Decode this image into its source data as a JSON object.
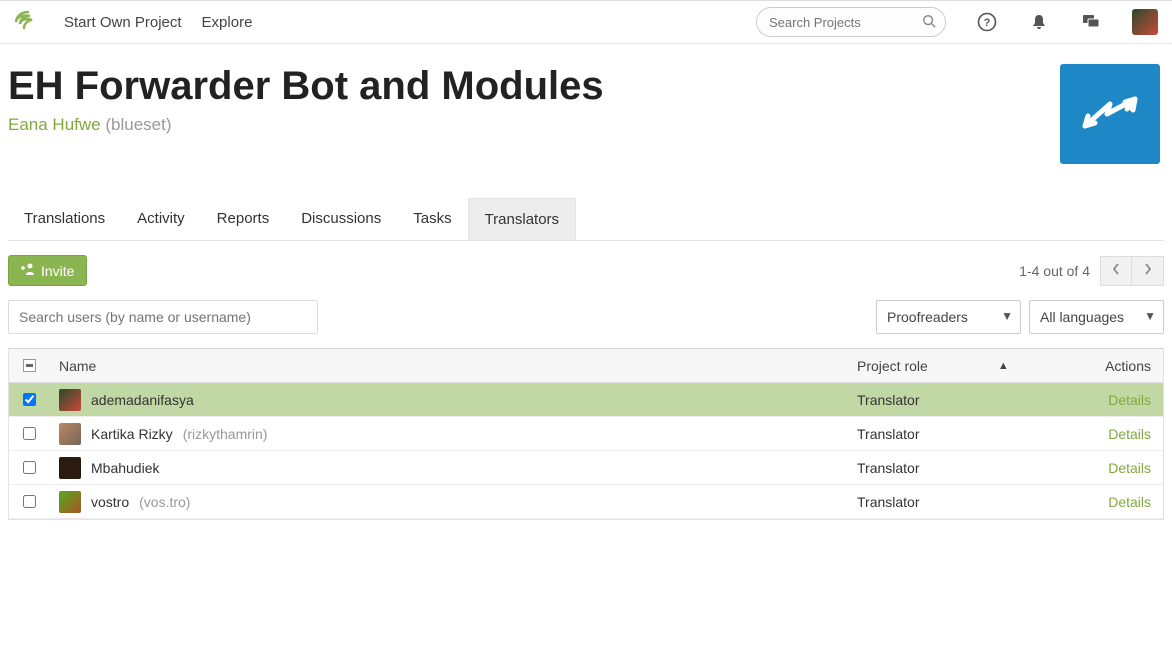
{
  "nav": {
    "start": "Start Own Project",
    "explore": "Explore"
  },
  "search": {
    "placeholder": "Search Projects"
  },
  "header": {
    "title": "EH Forwarder Bot and Modules",
    "owner_name": "Eana Hufwe",
    "owner_username": "(blueset)"
  },
  "tabs": {
    "translations": "Translations",
    "activity": "Activity",
    "reports": "Reports",
    "discussions": "Discussions",
    "tasks": "Tasks",
    "translators": "Translators"
  },
  "toolbar": {
    "invite": "Invite",
    "pager": "1-4 out of 4"
  },
  "filters": {
    "search_placeholder": "Search users (by name or username)",
    "role": "Proofreaders",
    "lang": "All languages"
  },
  "table": {
    "head": {
      "name": "Name",
      "role": "Project role",
      "actions": "Actions"
    },
    "rows": [
      {
        "selected": true,
        "name": "ademadanifasya",
        "sub": "",
        "role": "Translator",
        "action": "Details",
        "avatar_bg": "linear-gradient(135deg,#2a4a2a,#c94a3a)"
      },
      {
        "selected": false,
        "name": "Kartika Rizky ",
        "sub": "(rizkythamrin)",
        "role": "Translator",
        "action": "Details",
        "avatar_bg": "linear-gradient(135deg,#b86,#765)"
      },
      {
        "selected": false,
        "name": "Mbahudiek",
        "sub": "",
        "role": "Translator",
        "action": "Details",
        "avatar_bg": "#2b1a10"
      },
      {
        "selected": false,
        "name": "vostro ",
        "sub": "(vos.tro)",
        "role": "Translator",
        "action": "Details",
        "avatar_bg": "linear-gradient(135deg,#5a2,#a52)"
      }
    ]
  }
}
